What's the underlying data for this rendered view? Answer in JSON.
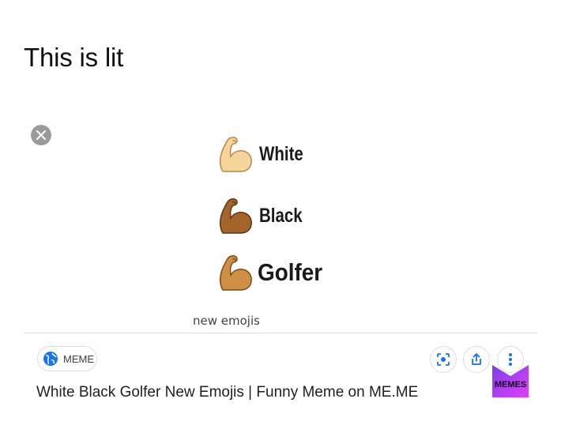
{
  "post": {
    "caption": "This is lit"
  },
  "meme": {
    "rows": [
      {
        "label": "White"
      },
      {
        "label": "Black"
      },
      {
        "label": "Golfer"
      }
    ],
    "image_caption": "new emojis"
  },
  "result": {
    "source_label": "MEME",
    "title": "White Black Golfer New Emojis | Funny Meme on ME.ME"
  },
  "brand": {
    "logo_text": "MEMES"
  },
  "colors": {
    "arm_white": "#f6d59a",
    "arm_black": "#a5642a",
    "arm_golfer": "#cf8f45",
    "close_bg": "#9b9b9b",
    "icon_blue": "#1a73e8",
    "logo_purple": "#7b3fe4",
    "logo_pink": "#e040fb"
  },
  "icons": {
    "close": "close-icon",
    "globe": "globe-icon",
    "lens": "lens-icon",
    "share": "share-icon",
    "more": "more-vertical-icon"
  }
}
